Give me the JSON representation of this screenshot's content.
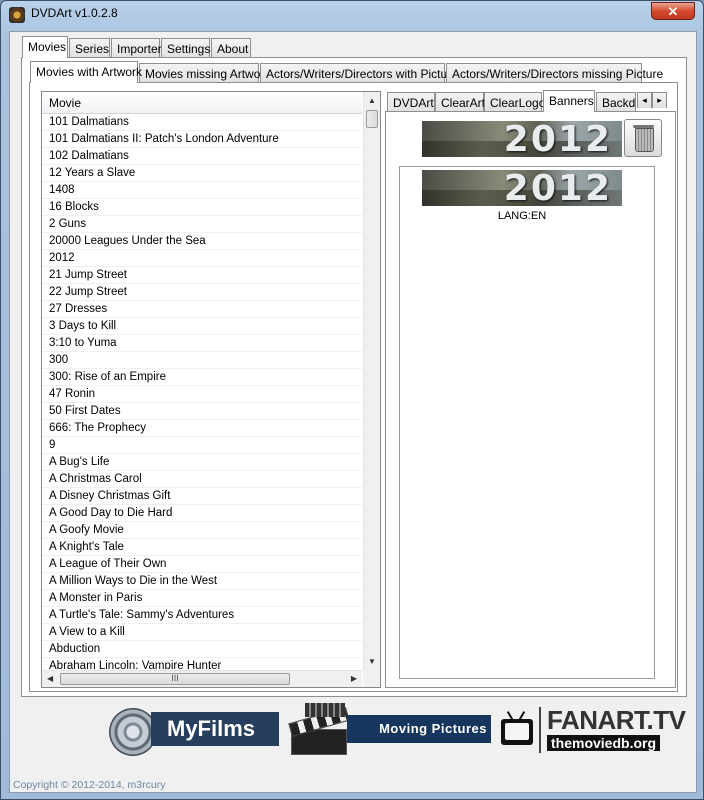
{
  "window": {
    "title": "DVDArt v1.0.2.8",
    "close_glyph": "✕"
  },
  "main_tabs": [
    "Movies",
    "Series",
    "Importer",
    "Settings",
    "About"
  ],
  "sub_tabs": [
    "Movies with Artwork",
    "Movies missing Artwork",
    "Actors/Writers/Directors with Picture",
    "Actors/Writers/Directors missing Picture"
  ],
  "art_tabs": [
    "DVDArt",
    "ClearArt",
    "ClearLogo",
    "Banners",
    "Backdr"
  ],
  "art_tab_arrows": {
    "left": "◂",
    "right": "▸"
  },
  "list": {
    "header": "Movie",
    "rows": [
      "101 Dalmatians",
      "101 Dalmatians II: Patch's London Adventure",
      "102 Dalmatians",
      "12 Years a Slave",
      "1408",
      "16 Blocks",
      "2 Guns",
      "20000 Leagues Under the Sea",
      "2012",
      "21 Jump Street",
      "22 Jump Street",
      "27 Dresses",
      "3 Days to Kill",
      "3:10 to Yuma",
      "300",
      "300: Rise of an Empire",
      "47 Ronin",
      "50 First Dates",
      "666: The Prophecy",
      "9",
      "A Bug's Life",
      "A Christmas Carol",
      "A Disney Christmas Gift",
      "A Good Day to Die Hard",
      "A Goofy Movie",
      "A Knight's Tale",
      "A League of Their Own",
      "A Million Ways to Die in the West",
      "A Monster in Paris",
      "A Turtle's Tale: Sammy's Adventures",
      "A View to a Kill",
      "Abduction",
      "Abraham Lincoln: Vampire Hunter"
    ],
    "scroll_up": "▲",
    "scroll_down": "▼",
    "scroll_left": "◀",
    "scroll_right": "▶",
    "hgrip": "III"
  },
  "banner": {
    "current_text": "2012",
    "option_text": "2012",
    "option_caption": "LANG:EN"
  },
  "footer": {
    "myfilms": "MyFilms",
    "moving_pictures": "Moving Pictures",
    "fanart": "FANART.TV",
    "tmdb": "themoviedb.org",
    "copyright": "Copyright © 2012-2014, m3rcury"
  },
  "colors": {
    "myfilms_bg": "#273f5f",
    "moving_bg": "#17365e",
    "accent": "#3a5f8f"
  }
}
